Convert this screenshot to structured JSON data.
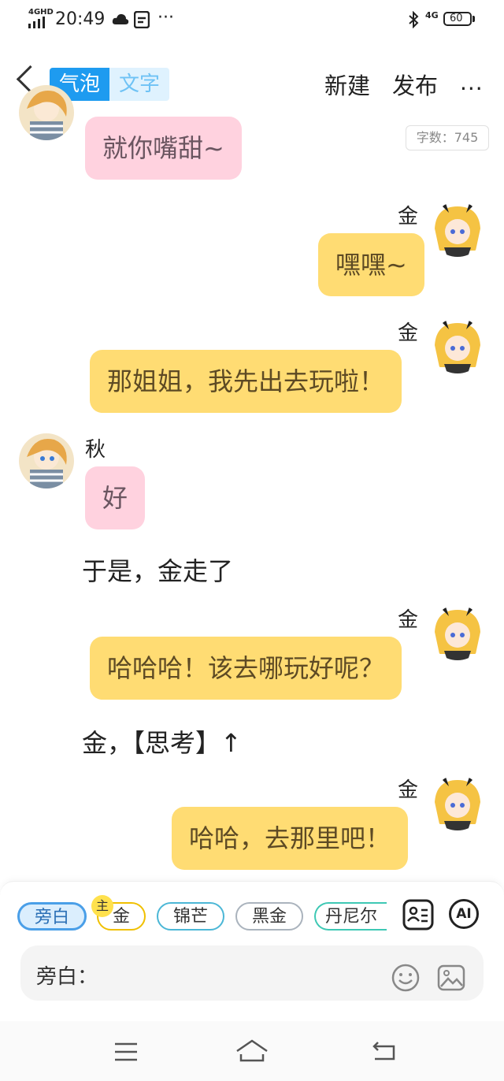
{
  "status_bar": {
    "network": "4GHD",
    "time": "20:49",
    "more": "···",
    "right_network": "4G",
    "battery": "60"
  },
  "header": {
    "tab_bubble": "气泡",
    "tab_text": "文字",
    "new_label": "新建",
    "publish_label": "发布",
    "more_label": "···"
  },
  "word_count": "字数：745",
  "messages": [
    {
      "type": "bubble",
      "speaker": "",
      "text": "就你嘴甜~"
    },
    {
      "type": "bubble",
      "speaker": "金",
      "text": "嘿嘿~"
    },
    {
      "type": "bubble",
      "speaker": "金",
      "text": "那姐姐，我先出去玩啦！"
    },
    {
      "type": "bubble",
      "speaker": "秋",
      "text": "好"
    },
    {
      "type": "narration",
      "text": "于是，金走了"
    },
    {
      "type": "bubble",
      "speaker": "金",
      "text": "哈哈哈！该去哪玩好呢？"
    },
    {
      "type": "narration",
      "text": "金，【思考】↑"
    },
    {
      "type": "bubble",
      "speaker": "金",
      "text": "哈哈，去那里吧！"
    }
  ],
  "characters": {
    "chips": [
      "旁白",
      "金",
      "锦芒",
      "黑金",
      "丹尼尔"
    ],
    "main_badge": "主",
    "ai_label": "AI"
  },
  "input": {
    "prefix": "旁白："
  },
  "colors": {
    "accent_blue": "#1e9bf0",
    "bubble_pink": "#ffd2df",
    "bubble_yellow": "#ffdc73",
    "chip_yellow": "#f0c000"
  }
}
